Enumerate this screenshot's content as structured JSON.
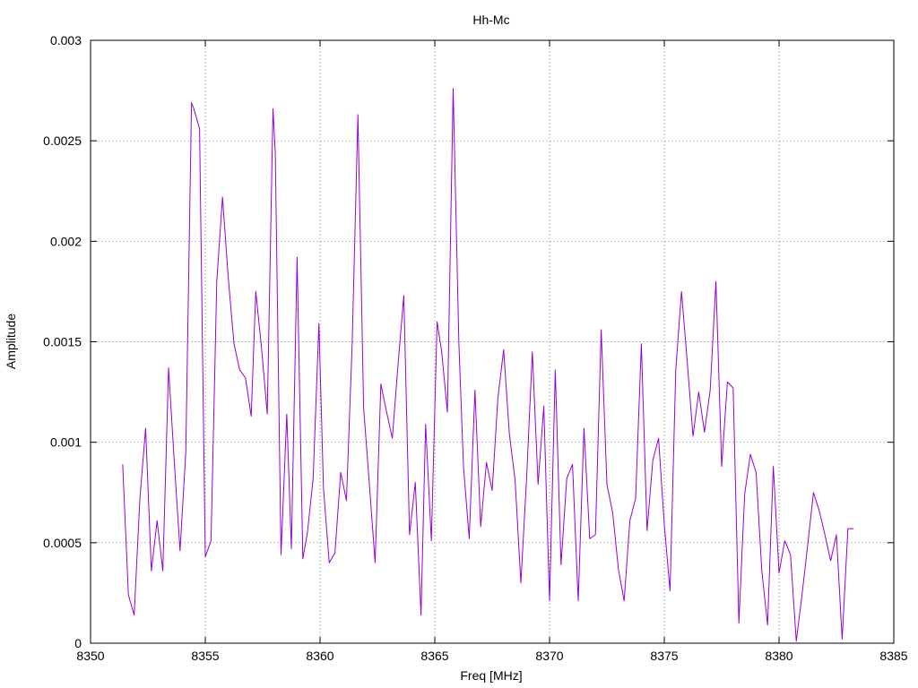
{
  "chart_data": {
    "type": "line",
    "title": "Hh-Mc",
    "xlabel": "Freq [MHz]",
    "ylabel": "Amplitude",
    "xlim": [
      8350,
      8385
    ],
    "ylim": [
      0,
      0.003
    ],
    "xticks": [
      8350,
      8355,
      8360,
      8365,
      8370,
      8375,
      8380,
      8385
    ],
    "yticks": [
      0,
      0.0005,
      0.001,
      0.0015,
      0.002,
      0.0025,
      0.003
    ],
    "xtick_labels": [
      "8350",
      "8355",
      "8360",
      "8365",
      "8370",
      "8375",
      "8380",
      "8385"
    ],
    "ytick_labels": [
      "0",
      "0.0005",
      "0.001",
      "0.0015",
      "0.002",
      "0.0025",
      "0.003"
    ],
    "grid": true,
    "series": [
      {
        "color": "#9400d3",
        "x": [
          8351.4,
          8351.65,
          8351.9,
          8352.15,
          8352.4,
          8352.65,
          8352.9,
          8353.15,
          8353.4,
          8353.65,
          8353.9,
          8354.15,
          8354.4,
          8354.5,
          8354.75,
          8355.0,
          8355.25,
          8355.5,
          8355.75,
          8356.0,
          8356.25,
          8356.5,
          8356.75,
          8357.0,
          8357.2,
          8357.45,
          8357.7,
          8357.95,
          8358.05,
          8358.3,
          8358.55,
          8358.75,
          8359.0,
          8359.25,
          8359.45,
          8359.7,
          8359.95,
          8360.15,
          8360.4,
          8360.65,
          8360.9,
          8361.15,
          8361.4,
          8361.65,
          8361.9,
          8362.15,
          8362.4,
          8362.65,
          8362.9,
          8363.15,
          8363.4,
          8363.65,
          8363.9,
          8364.15,
          8364.4,
          8364.6,
          8364.85,
          8365.1,
          8365.3,
          8365.55,
          8365.8,
          8366.05,
          8366.25,
          8366.5,
          8366.75,
          8367.0,
          8367.25,
          8367.5,
          8367.75,
          8368.0,
          8368.25,
          8368.5,
          8368.75,
          8369.0,
          8369.25,
          8369.5,
          8369.75,
          8370.0,
          8370.25,
          8370.5,
          8370.75,
          8371.0,
          8371.25,
          8371.5,
          8371.75,
          8372.0,
          8372.25,
          8372.5,
          8372.75,
          8373.0,
          8373.25,
          8373.5,
          8373.75,
          8374.0,
          8374.25,
          8374.5,
          8374.75,
          8375.0,
          8375.25,
          8375.5,
          8375.75,
          8376.0,
          8376.25,
          8376.5,
          8376.75,
          8377.0,
          8377.25,
          8377.5,
          8377.75,
          8378.0,
          8378.25,
          8378.5,
          8378.75,
          8379.0,
          8379.25,
          8379.5,
          8379.75,
          8380.0,
          8380.25,
          8380.5,
          8380.75,
          8381.0,
          8381.25,
          8381.5,
          8381.75,
          8382.0,
          8382.25,
          8382.5,
          8382.75,
          8383.0,
          8383.25
        ],
        "values": [
          0.00089,
          0.00024,
          0.00014,
          0.00072,
          0.00107,
          0.00036,
          0.00061,
          0.00036,
          0.00137,
          0.0009,
          0.00046,
          0.00095,
          0.00269,
          0.00266,
          0.00256,
          0.00043,
          0.00051,
          0.0018,
          0.00222,
          0.00182,
          0.00149,
          0.00136,
          0.00132,
          0.00113,
          0.00175,
          0.00147,
          0.00114,
          0.00266,
          0.00244,
          0.00044,
          0.00114,
          0.00047,
          0.00192,
          0.00042,
          0.00055,
          0.00082,
          0.00159,
          0.00077,
          0.0004,
          0.00045,
          0.00085,
          0.00071,
          0.00149,
          0.00263,
          0.00117,
          0.00079,
          0.0004,
          0.00129,
          0.00115,
          0.00102,
          0.00139,
          0.00173,
          0.00054,
          0.0008,
          0.00014,
          0.00109,
          0.00051,
          0.0016,
          0.00145,
          0.00115,
          0.00276,
          0.00149,
          0.00088,
          0.00052,
          0.00126,
          0.00058,
          0.0009,
          0.00076,
          0.00122,
          0.00146,
          0.00104,
          0.00081,
          0.0003,
          0.00082,
          0.00145,
          0.00079,
          0.00118,
          0.00021,
          0.00136,
          0.00039,
          0.00082,
          0.00089,
          0.00021,
          0.00107,
          0.00052,
          0.00054,
          0.00156,
          0.00079,
          0.00065,
          0.00037,
          0.00021,
          0.00061,
          0.00072,
          0.00149,
          0.00056,
          0.00091,
          0.00102,
          0.00059,
          0.00026,
          0.00136,
          0.00175,
          0.0014,
          0.00103,
          0.00125,
          0.00105,
          0.00126,
          0.0018,
          0.00088,
          0.0013,
          0.00127,
          0.0001,
          0.00074,
          0.00094,
          0.00085,
          0.00036,
          9e-05,
          0.00088,
          0.00035,
          0.00051,
          0.00044,
          1e-05,
          0.00024,
          0.00049,
          0.00075,
          0.00066,
          0.00054,
          0.00041,
          0.00054,
          2e-05,
          0.00057,
          0.00057
        ]
      }
    ]
  }
}
